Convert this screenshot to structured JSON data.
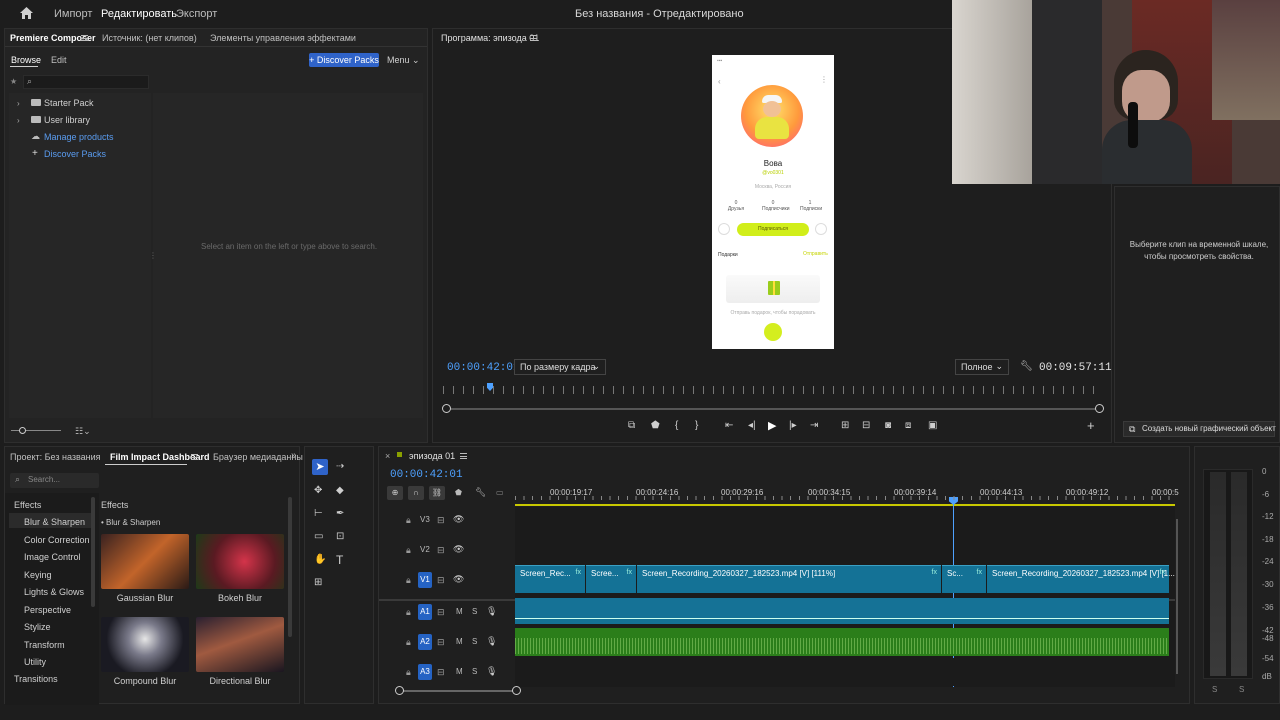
{
  "app": {
    "home_icon": "home-icon",
    "menu": [
      "Импорт",
      "Редактировать",
      "Экспорт"
    ],
    "title": "Без названия - Отредактировано"
  },
  "left_panel": {
    "tabs": [
      "Premiere Composer",
      "Источник: (нет клипов)",
      "Элементы управления эффектами"
    ],
    "subtabs": [
      "Browse",
      "Edit"
    ],
    "discover_btn": "+ Discover Packs",
    "menu_btn": "Menu",
    "tree": [
      "Starter Pack",
      "User library",
      "Manage products",
      "Discover Packs"
    ],
    "empty_msg": "Select an item on the left or type above to search."
  },
  "program": {
    "tab": "Программа: эпизода 01",
    "timecode_left": "00:00:42:01",
    "fit": "По размеру кадра",
    "quality": "Полное",
    "timecode_right": "00:09:57:11",
    "phone": {
      "name": "Вова",
      "handle": "@vo0301",
      "location": "Москва, Россия",
      "stats": [
        {
          "n": "0",
          "l": "Друзья"
        },
        {
          "n": "0",
          "l": "Подписчики"
        },
        {
          "n": "1",
          "l": "Подписки"
        }
      ],
      "subscribe": "Подписаться",
      "gifts": "Подарки",
      "send": "Отправить",
      "gift_note": "Отправь подарок, чтобы порадовать"
    }
  },
  "right_panel": {
    "message": "Выберите клип на временной шкале, чтобы просмотреть свойства.",
    "create_btn": "Создать новый графический объект"
  },
  "bottom_left": {
    "tabs": [
      "Проект: Без названия",
      "Film Impact Dashboard",
      "Браузер медиаданны"
    ],
    "search_placeholder": "Search...",
    "categories_header": "Effects",
    "categories": [
      "Effects",
      "Blur & Sharpen",
      "Color Correction",
      "Image Control",
      "Keying",
      "Lights & Glows",
      "Perspective",
      "Stylize",
      "Transform",
      "Utility",
      "Transitions"
    ],
    "effects_header": "Effects",
    "effects_sub": "• Blur & Sharpen",
    "thumbs": [
      "Gaussian Blur",
      "Bokeh Blur",
      "Compound Blur",
      "Directional Blur"
    ]
  },
  "timeline": {
    "tab": "эпизода 01",
    "timecode": "00:00:42:01",
    "ruler": [
      "00:00:19:17",
      "00:00:24:16",
      "00:00:29:16",
      "00:00:34:15",
      "00:00:39:14",
      "00:00:44:13",
      "00:00:49:12",
      "00:00:5"
    ],
    "tracks": [
      "V3",
      "V2",
      "V1",
      "A1",
      "A2",
      "A3"
    ],
    "ms": [
      "M",
      "S"
    ],
    "clips_v1": [
      "Screen_Rec...",
      "Scree...",
      "Screen_Recording_20260327_182523.mp4 [V] [111%]",
      "Sc...",
      "Screen_Recording_20260327_182523.mp4 [V] [1..."
    ],
    "fx": "fx"
  },
  "meter": {
    "labels": [
      "0",
      "-6",
      "-12",
      "-18",
      "-24",
      "-30",
      "-36",
      "-42",
      "-48",
      "-54",
      "dB"
    ],
    "solo": [
      "S",
      "S"
    ]
  },
  "colors": {
    "accent": "#4ea1ff",
    "video_clip": "#147296",
    "audio_clip": "#2b7e1a",
    "lime": "#c8f000"
  }
}
